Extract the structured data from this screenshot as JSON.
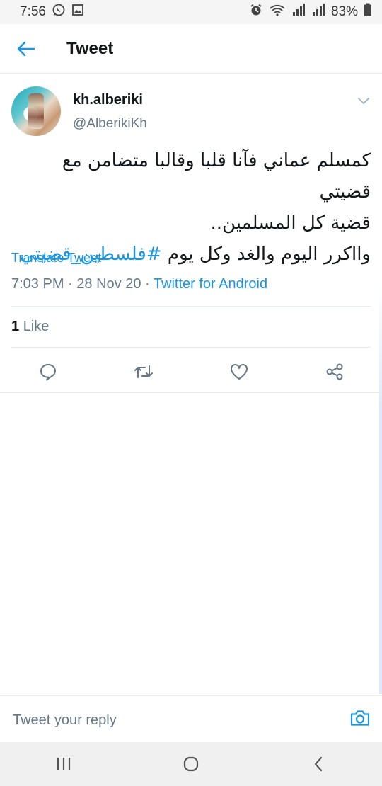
{
  "status_bar": {
    "time": "7:56",
    "battery": "83%"
  },
  "app_bar": {
    "title": "Tweet"
  },
  "tweet": {
    "author_name": "kh.alberiki",
    "author_handle": "@AlberikiKh",
    "text_line1": "كمسلم عماني فآنا قلبا وقالبا متضامن مع قضيتي",
    "text_line2": "قضية كل المسلمين..",
    "text_line3": "وااكرر اليوم والغد وكل يوم",
    "hashtag": "#فلسطين_قضيتي",
    "translate_label": "Translate Tweet",
    "time": "7:03 PM",
    "date": "28 Nov 20",
    "separator": "·",
    "source": "Twitter for Android",
    "like_count": "1",
    "like_label": "Like"
  },
  "reply": {
    "placeholder": "Tweet your reply"
  },
  "colors": {
    "accent": "#1b95e0",
    "secondary_text": "#657786",
    "divider": "#e6ecf0"
  },
  "icons": [
    "back-arrow-icon",
    "chevron-down-icon",
    "reply-icon",
    "retweet-icon",
    "heart-icon",
    "share-icon",
    "camera-icon",
    "recent-apps-icon",
    "home-icon",
    "nav-back-icon"
  ]
}
